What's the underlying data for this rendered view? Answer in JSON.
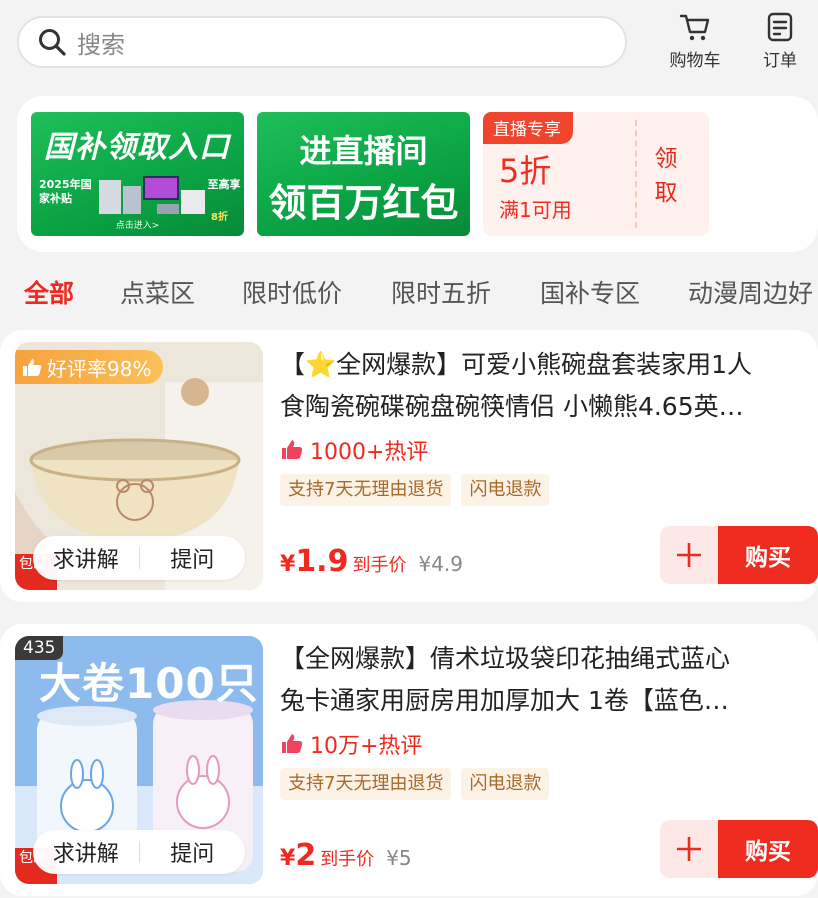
{
  "search": {
    "placeholder": "搜索"
  },
  "header": {
    "cart_label": "购物车",
    "orders_label": "订单"
  },
  "promo": {
    "tile1": {
      "title": "国补领取入口",
      "year_text": "2025年国家补贴",
      "discount_prefix": "至高享",
      "discount": "8折",
      "enter": "点击进入>"
    },
    "tile2": {
      "line1": "进直播间",
      "line2": "领百万红包"
    },
    "coupon": {
      "tag": "直播专享",
      "value": "5折",
      "condition": "满1可用",
      "claim": "领取"
    }
  },
  "tabs": [
    {
      "label": "全部",
      "active": true
    },
    {
      "label": "点菜区",
      "active": false
    },
    {
      "label": "限时低价",
      "active": false
    },
    {
      "label": "限时五折",
      "active": false
    },
    {
      "label": "国补专区",
      "active": false
    },
    {
      "label": "动漫周边好",
      "active": false
    }
  ],
  "products": [
    {
      "badge": "好评率98%",
      "shipping_tag": "包邮",
      "title_line1": "【⭐全网爆款】可爱小熊碗盘套装家用1人",
      "title_line2": "食陶瓷碗碟碗盘碗筷情侣 小懒熊4.65英…",
      "reviews": "1000+热评",
      "chips": [
        "支持7天无理由退货",
        "闪电退款"
      ],
      "price_currency": "¥",
      "price": "1.9",
      "price_label": "到手价",
      "original_price": "¥4.9",
      "explain_label": "求讲解",
      "ask_label": "提问",
      "add_label": "+",
      "buy_label": "购买"
    },
    {
      "rank": "435",
      "bundle_text": "大卷100只",
      "shipping_tag": "包邮",
      "title_line1": "【全网爆款】倩术垃圾袋印花抽绳式蓝心",
      "title_line2": "兔卡通家用厨房用加厚加大 1卷【蓝色…",
      "reviews": "10万+热评",
      "chips": [
        "支持7天无理由退货",
        "闪电退款"
      ],
      "price_currency": "¥",
      "price": "2",
      "price_label": "到手价",
      "original_price": "¥5",
      "explain_label": "求讲解",
      "ask_label": "提问",
      "add_label": "+",
      "buy_label": "购买"
    }
  ],
  "colors": {
    "accent": "#ee2a20",
    "promo_green": "#0aa344",
    "rating_badge": "#f7a23d"
  }
}
